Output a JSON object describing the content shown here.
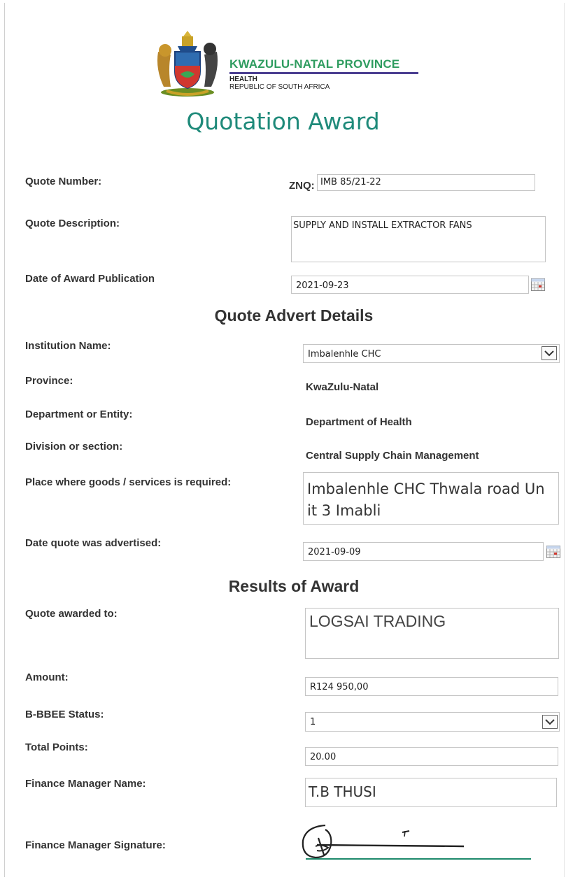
{
  "header": {
    "province": "KWAZULU-NATAL PROVINCE",
    "line1": "HEALTH",
    "line2": "REPUBLIC OF SOUTH AFRICA",
    "brand_color": "#2e9c5f",
    "rule_color": "#4b3f91"
  },
  "title": "Quotation Award",
  "quote": {
    "number_label": "Quote Number:",
    "number_prefix": "ZNQ:",
    "number_value": "IMB 85/21-22",
    "description_label": "Quote Description:",
    "description_value": "SUPPLY AND INSTALL EXTRACTOR FANS",
    "award_date_label": "Date of Award Publication",
    "award_date_value": "2021-09-23"
  },
  "advert": {
    "heading": "Quote Advert Details",
    "institution_label": "Institution Name:",
    "institution_value": "Imbalenhle CHC",
    "province_label": "Province:",
    "province_value": "KwaZulu-Natal",
    "department_label": "Department or Entity:",
    "department_value": "Department of Health",
    "division_label": "Division or section:",
    "division_value": "Central Supply Chain Management",
    "place_label": "Place where goods /  services is required:",
    "place_value_line1": "Imbalenhle CHC Thwala road Un",
    "place_value_line2": "it 3 Imabli",
    "advertised_label": "Date quote was advertised:",
    "advertised_value": "2021-09-09"
  },
  "results": {
    "heading": "Results of Award",
    "awarded_label": "Quote awarded to:",
    "awarded_value": "LOGSAI TRADING",
    "amount_label": "Amount:",
    "amount_value": "R124 950,00",
    "bbbee_label": "B-BBEE Status:",
    "bbbee_value": "1",
    "points_label": "Total Points:",
    "points_value": "20.00",
    "manager_label": "Finance Manager Name:",
    "manager_value": "T.B THUSI",
    "signature_label": "Finance Manager Signature:"
  },
  "icons": {
    "calendar": "calendar-icon",
    "dropdown": "chevron-down-icon",
    "crest": "coat-of-arms-icon",
    "signature": "signature-icon"
  }
}
